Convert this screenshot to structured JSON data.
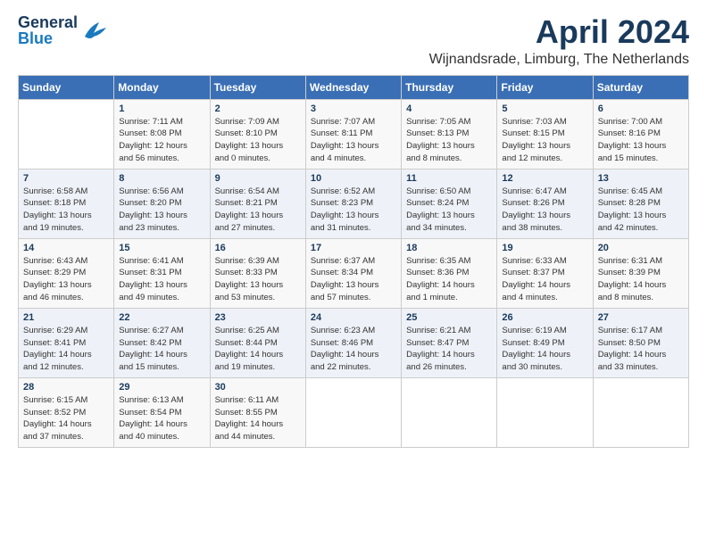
{
  "logo": {
    "general": "General",
    "blue": "Blue"
  },
  "title": "April 2024",
  "subtitle": "Wijnandsrade, Limburg, The Netherlands",
  "weekdays": [
    "Sunday",
    "Monday",
    "Tuesday",
    "Wednesday",
    "Thursday",
    "Friday",
    "Saturday"
  ],
  "weeks": [
    [
      {
        "day": "",
        "info": ""
      },
      {
        "day": "1",
        "info": "Sunrise: 7:11 AM\nSunset: 8:08 PM\nDaylight: 12 hours\nand 56 minutes."
      },
      {
        "day": "2",
        "info": "Sunrise: 7:09 AM\nSunset: 8:10 PM\nDaylight: 13 hours\nand 0 minutes."
      },
      {
        "day": "3",
        "info": "Sunrise: 7:07 AM\nSunset: 8:11 PM\nDaylight: 13 hours\nand 4 minutes."
      },
      {
        "day": "4",
        "info": "Sunrise: 7:05 AM\nSunset: 8:13 PM\nDaylight: 13 hours\nand 8 minutes."
      },
      {
        "day": "5",
        "info": "Sunrise: 7:03 AM\nSunset: 8:15 PM\nDaylight: 13 hours\nand 12 minutes."
      },
      {
        "day": "6",
        "info": "Sunrise: 7:00 AM\nSunset: 8:16 PM\nDaylight: 13 hours\nand 15 minutes."
      }
    ],
    [
      {
        "day": "7",
        "info": "Sunrise: 6:58 AM\nSunset: 8:18 PM\nDaylight: 13 hours\nand 19 minutes."
      },
      {
        "day": "8",
        "info": "Sunrise: 6:56 AM\nSunset: 8:20 PM\nDaylight: 13 hours\nand 23 minutes."
      },
      {
        "day": "9",
        "info": "Sunrise: 6:54 AM\nSunset: 8:21 PM\nDaylight: 13 hours\nand 27 minutes."
      },
      {
        "day": "10",
        "info": "Sunrise: 6:52 AM\nSunset: 8:23 PM\nDaylight: 13 hours\nand 31 minutes."
      },
      {
        "day": "11",
        "info": "Sunrise: 6:50 AM\nSunset: 8:24 PM\nDaylight: 13 hours\nand 34 minutes."
      },
      {
        "day": "12",
        "info": "Sunrise: 6:47 AM\nSunset: 8:26 PM\nDaylight: 13 hours\nand 38 minutes."
      },
      {
        "day": "13",
        "info": "Sunrise: 6:45 AM\nSunset: 8:28 PM\nDaylight: 13 hours\nand 42 minutes."
      }
    ],
    [
      {
        "day": "14",
        "info": "Sunrise: 6:43 AM\nSunset: 8:29 PM\nDaylight: 13 hours\nand 46 minutes."
      },
      {
        "day": "15",
        "info": "Sunrise: 6:41 AM\nSunset: 8:31 PM\nDaylight: 13 hours\nand 49 minutes."
      },
      {
        "day": "16",
        "info": "Sunrise: 6:39 AM\nSunset: 8:33 PM\nDaylight: 13 hours\nand 53 minutes."
      },
      {
        "day": "17",
        "info": "Sunrise: 6:37 AM\nSunset: 8:34 PM\nDaylight: 13 hours\nand 57 minutes."
      },
      {
        "day": "18",
        "info": "Sunrise: 6:35 AM\nSunset: 8:36 PM\nDaylight: 14 hours\nand 1 minute."
      },
      {
        "day": "19",
        "info": "Sunrise: 6:33 AM\nSunset: 8:37 PM\nDaylight: 14 hours\nand 4 minutes."
      },
      {
        "day": "20",
        "info": "Sunrise: 6:31 AM\nSunset: 8:39 PM\nDaylight: 14 hours\nand 8 minutes."
      }
    ],
    [
      {
        "day": "21",
        "info": "Sunrise: 6:29 AM\nSunset: 8:41 PM\nDaylight: 14 hours\nand 12 minutes."
      },
      {
        "day": "22",
        "info": "Sunrise: 6:27 AM\nSunset: 8:42 PM\nDaylight: 14 hours\nand 15 minutes."
      },
      {
        "day": "23",
        "info": "Sunrise: 6:25 AM\nSunset: 8:44 PM\nDaylight: 14 hours\nand 19 minutes."
      },
      {
        "day": "24",
        "info": "Sunrise: 6:23 AM\nSunset: 8:46 PM\nDaylight: 14 hours\nand 22 minutes."
      },
      {
        "day": "25",
        "info": "Sunrise: 6:21 AM\nSunset: 8:47 PM\nDaylight: 14 hours\nand 26 minutes."
      },
      {
        "day": "26",
        "info": "Sunrise: 6:19 AM\nSunset: 8:49 PM\nDaylight: 14 hours\nand 30 minutes."
      },
      {
        "day": "27",
        "info": "Sunrise: 6:17 AM\nSunset: 8:50 PM\nDaylight: 14 hours\nand 33 minutes."
      }
    ],
    [
      {
        "day": "28",
        "info": "Sunrise: 6:15 AM\nSunset: 8:52 PM\nDaylight: 14 hours\nand 37 minutes."
      },
      {
        "day": "29",
        "info": "Sunrise: 6:13 AM\nSunset: 8:54 PM\nDaylight: 14 hours\nand 40 minutes."
      },
      {
        "day": "30",
        "info": "Sunrise: 6:11 AM\nSunset: 8:55 PM\nDaylight: 14 hours\nand 44 minutes."
      },
      {
        "day": "",
        "info": ""
      },
      {
        "day": "",
        "info": ""
      },
      {
        "day": "",
        "info": ""
      },
      {
        "day": "",
        "info": ""
      }
    ]
  ]
}
